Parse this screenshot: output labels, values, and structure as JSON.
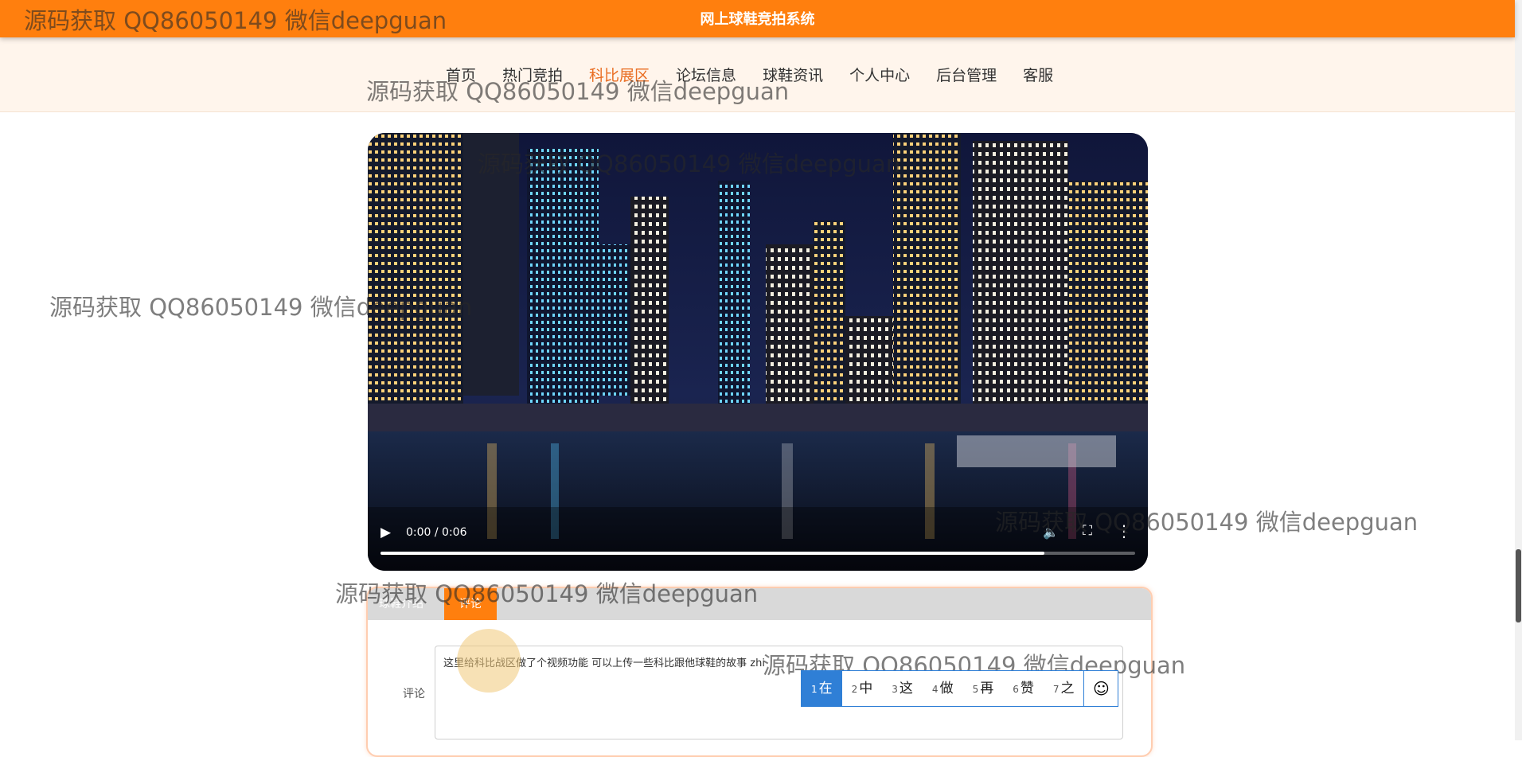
{
  "header": {
    "site_title": "网上球鞋竞拍系统"
  },
  "nav": {
    "items": [
      "首页",
      "热门竞拍",
      "科比展区",
      "论坛信息",
      "球鞋资讯",
      "个人中心",
      "后台管理",
      "客服"
    ],
    "active": "科比展区"
  },
  "video": {
    "time": "0:00 / 0:06",
    "progress_buffered_fraction": 0.88,
    "icons": [
      "play-icon",
      "volume-icon",
      "fullscreen-icon",
      "more-icon"
    ]
  },
  "panel": {
    "tabs": [
      "球鞋介绍",
      "评论"
    ],
    "active_tab": "评论",
    "comment_label": "评论",
    "comment_text": "这里给科比战区做了个视频功能  可以上传一些科比跟他球鞋的故事 zhi"
  },
  "ime": {
    "candidates": [
      {
        "num": "1",
        "text": "在"
      },
      {
        "num": "2",
        "text": "中"
      },
      {
        "num": "3",
        "text": "这"
      },
      {
        "num": "4",
        "text": "做"
      },
      {
        "num": "5",
        "text": "再"
      },
      {
        "num": "6",
        "text": "赞"
      },
      {
        "num": "7",
        "text": "之"
      }
    ],
    "emoji_icon": "smiley-icon"
  },
  "watermark": "源码获取 QQ86050149 微信deepguan",
  "colors": {
    "accent": "#ff7f0e",
    "nav_active": "#e96d22",
    "ime_selected": "#2f7fd6"
  }
}
